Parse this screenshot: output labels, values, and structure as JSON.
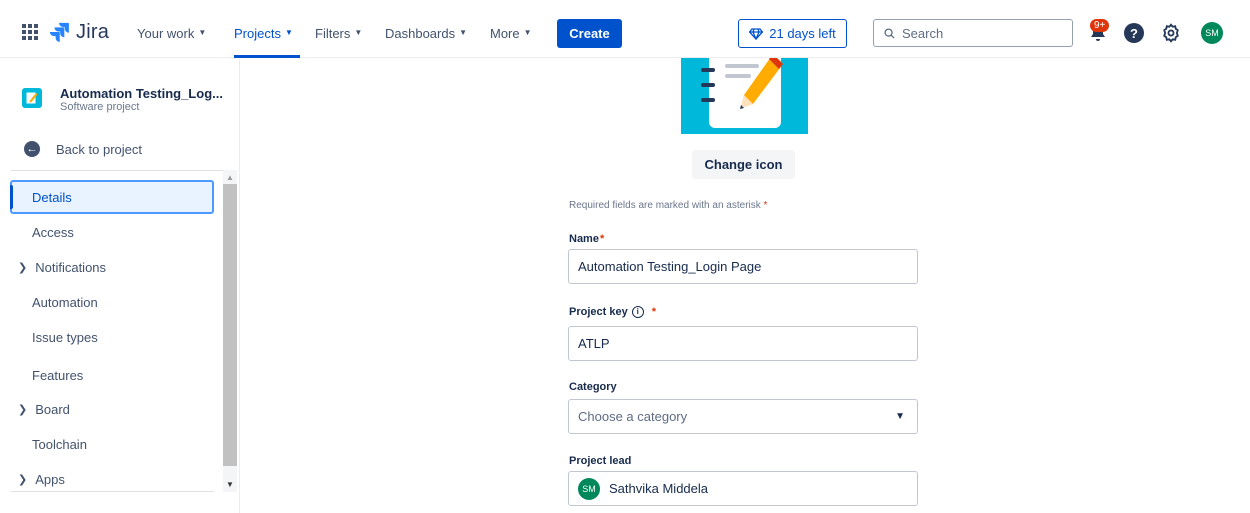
{
  "topnav": {
    "logo_text": "Jira",
    "items": [
      {
        "label": "Your work",
        "active": false
      },
      {
        "label": "Projects",
        "active": true
      },
      {
        "label": "Filters",
        "active": false
      },
      {
        "label": "Dashboards",
        "active": false
      },
      {
        "label": "More",
        "active": false
      }
    ],
    "create_label": "Create",
    "trial_label": "21 days left",
    "search_placeholder": "Search",
    "notification_badge": "9+",
    "help_symbol": "?",
    "avatar_initials": "SM",
    "colors": {
      "accent": "#0052cc",
      "avatar": "#00875a",
      "badge": "#de350b"
    }
  },
  "sidebar": {
    "project_name": "Automation Testing_Log...",
    "project_type": "Software project",
    "back_label": "Back to project",
    "items": [
      {
        "label": "Details",
        "selected": true,
        "expandable": false
      },
      {
        "label": "Access",
        "selected": false,
        "expandable": false
      },
      {
        "label": "Notifications",
        "selected": false,
        "expandable": true
      },
      {
        "label": "Automation",
        "selected": false,
        "expandable": false
      },
      {
        "label": "Issue types",
        "selected": false,
        "expandable": false
      },
      {
        "label": "Features",
        "selected": false,
        "expandable": false
      },
      {
        "label": "Board",
        "selected": false,
        "expandable": true
      },
      {
        "label": "Toolchain",
        "selected": false,
        "expandable": false
      },
      {
        "label": "Apps",
        "selected": false,
        "expandable": true
      }
    ]
  },
  "form": {
    "change_icon_label": "Change icon",
    "required_note": "Required fields are marked with an asterisk",
    "asterisk": "*",
    "name_label": "Name",
    "name_value": "Automation Testing_Login Page",
    "key_label": "Project key",
    "key_value": "ATLP",
    "category_label": "Category",
    "category_placeholder": "Choose a category",
    "lead_label": "Project lead",
    "lead_initials": "SM",
    "lead_name": "Sathvika Middela"
  }
}
